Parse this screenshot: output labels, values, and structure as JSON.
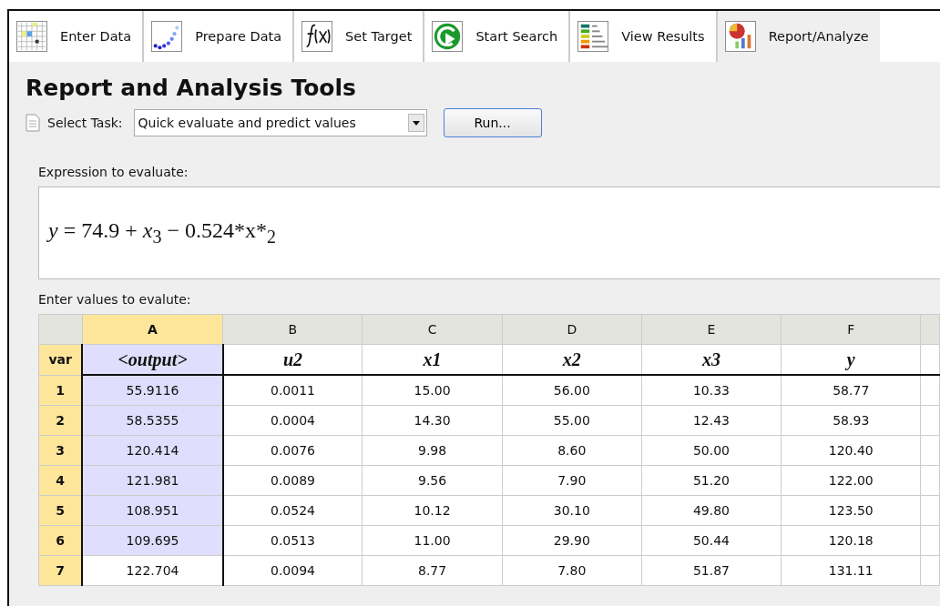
{
  "tabs": [
    {
      "label": "Enter Data",
      "selected": false
    },
    {
      "label": "Prepare Data",
      "selected": false
    },
    {
      "label": "Set Target",
      "selected": false
    },
    {
      "label": "Start Search",
      "selected": false
    },
    {
      "label": "View Results",
      "selected": false
    },
    {
      "label": "Report/Analyze",
      "selected": true
    }
  ],
  "title": "Report and Analysis Tools",
  "task": {
    "label": "Select Task:",
    "value": "Quick evaluate and predict values",
    "button": "Run..."
  },
  "expression": {
    "label": "Expression to evaluate:",
    "formula": "*y* = 74.9 + *x*$_{3}$ − 0.524*x*$_{2}$"
  },
  "table": {
    "label": "Enter values to evalute:",
    "columns": [
      "A",
      "B",
      "C",
      "D",
      "E",
      "F"
    ],
    "row_label": "var",
    "variables": [
      "<output>",
      "u2",
      "x1",
      "x2",
      "x3",
      "y"
    ],
    "rows": [
      {
        "index": "1",
        "selected": true,
        "cells": [
          "55.9116",
          "0.0011",
          "15.00",
          "56.00",
          "10.33",
          "58.77"
        ]
      },
      {
        "index": "2",
        "selected": true,
        "cells": [
          "58.5355",
          "0.0004",
          "14.30",
          "55.00",
          "12.43",
          "58.93"
        ]
      },
      {
        "index": "3",
        "selected": true,
        "cells": [
          "120.414",
          "0.0076",
          "9.98",
          "8.60",
          "50.00",
          "120.40"
        ]
      },
      {
        "index": "4",
        "selected": true,
        "cells": [
          "121.981",
          "0.0089",
          "9.56",
          "7.90",
          "51.20",
          "122.00"
        ]
      },
      {
        "index": "5",
        "selected": true,
        "cells": [
          "108.951",
          "0.0524",
          "10.12",
          "30.10",
          "49.80",
          "123.50"
        ]
      },
      {
        "index": "6",
        "selected": true,
        "cells": [
          "109.695",
          "0.0513",
          "11.00",
          "29.90",
          "50.44",
          "120.18"
        ]
      },
      {
        "index": "7",
        "selected": false,
        "cells": [
          "122.704",
          "0.0094",
          "8.77",
          "7.80",
          "51.87",
          "131.11"
        ]
      }
    ]
  }
}
